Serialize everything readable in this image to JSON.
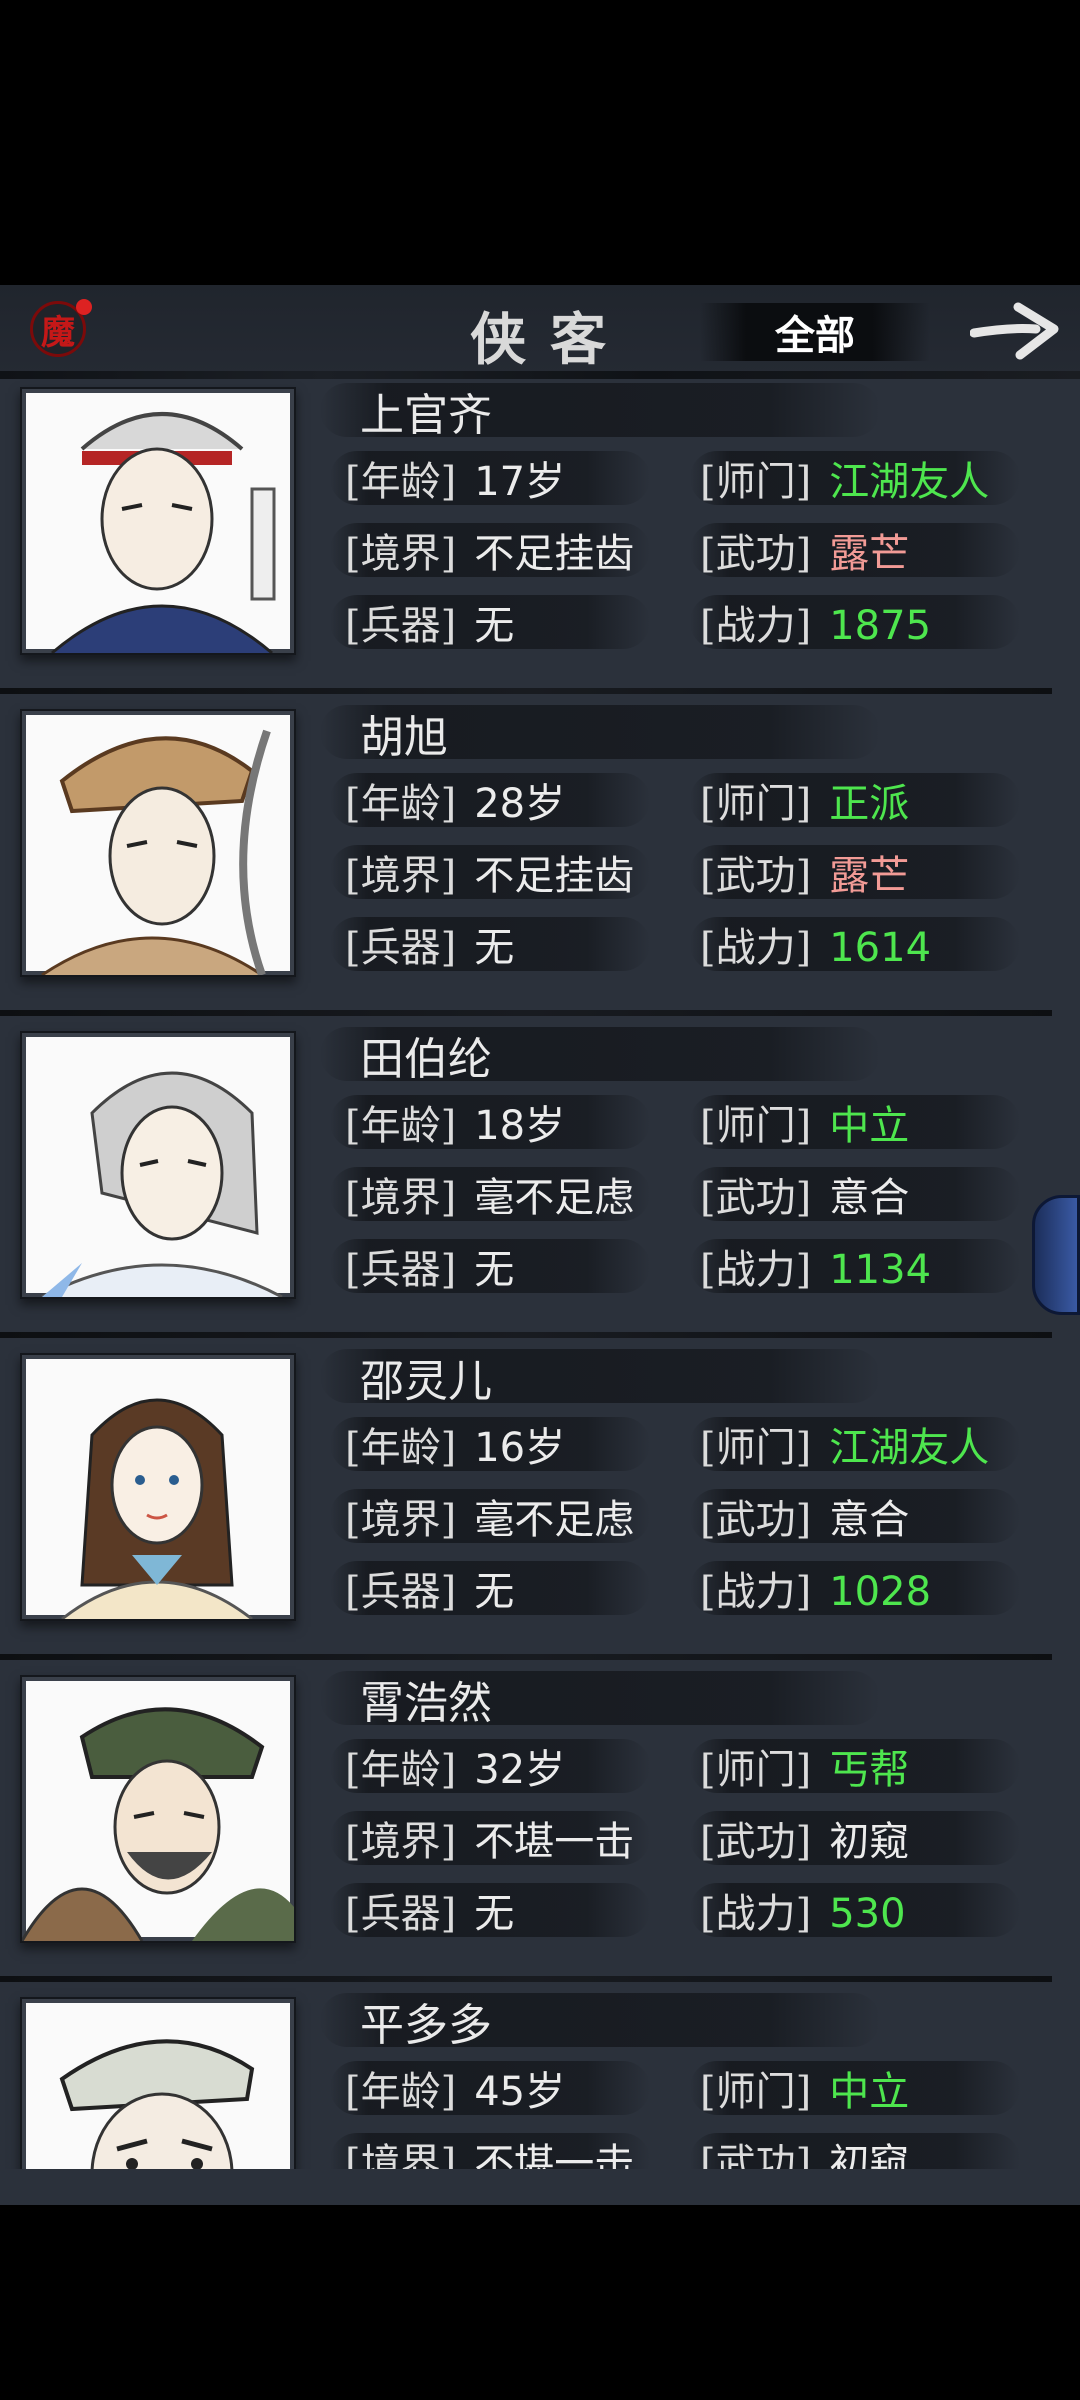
{
  "header": {
    "mo_icon_char": "魔",
    "title": "侠客",
    "filter_label": "全部",
    "icons": [
      "mo-badge-icon",
      "arrow-right-icon"
    ]
  },
  "labels": {
    "age": "[年龄]",
    "realm": "[境界]",
    "weapon": "[兵器]",
    "sect": "[师门]",
    "skill": "[武功]",
    "power": "[战力]"
  },
  "heroes": [
    {
      "name": "上官齐",
      "age": "17岁",
      "realm": "不足挂齿",
      "weapon": "无",
      "sect": "江湖友人",
      "skill": "露芒",
      "power": "1875"
    },
    {
      "name": "胡旭",
      "age": "28岁",
      "realm": "不足挂齿",
      "weapon": "无",
      "sect": "正派",
      "skill": "露芒",
      "power": "1614"
    },
    {
      "name": "田伯纶",
      "age": "18岁",
      "realm": "毫不足虑",
      "weapon": "无",
      "sect": "中立",
      "skill": "意合",
      "power": "1134"
    },
    {
      "name": "邵灵儿",
      "age": "16岁",
      "realm": "毫不足虑",
      "weapon": "无",
      "sect": "江湖友人",
      "skill": "意合",
      "power": "1028"
    },
    {
      "name": "霄浩然",
      "age": "32岁",
      "realm": "不堪一击",
      "weapon": "无",
      "sect": "丐帮",
      "skill": "初窥",
      "power": "530"
    },
    {
      "name": "平多多",
      "age": "45岁",
      "realm": "不堪一击",
      "weapon": "",
      "sect": "中立",
      "skill": "初窥",
      "power": ""
    }
  ],
  "colors": {
    "green": "#4ee64e",
    "pink": "#f29b96",
    "background": "#2b313b"
  }
}
